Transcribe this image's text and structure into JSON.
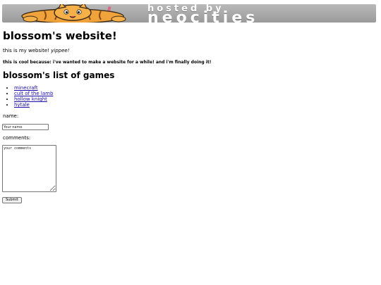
{
  "banner": {
    "hosted_text": "hosted by",
    "brand_text": "neocities"
  },
  "page": {
    "title": "blossom's website!",
    "intro_prefix": "this is my website! ",
    "intro_emphasis": "yippee!",
    "cool_text": "this is cool because: i've wanted to make a website for a while! and i'm finally doing it!"
  },
  "games": {
    "heading": "blossom's list of games",
    "items": [
      {
        "label": "minecraft"
      },
      {
        "label": "cult of the lamb"
      },
      {
        "label": "hollow knight"
      },
      {
        "label": "hytale"
      }
    ]
  },
  "form": {
    "name_label": "name:",
    "name_placeholder": "Your name",
    "comments_label": "comments:",
    "comments_placeholder": "your comments",
    "submit_label": "Submit"
  },
  "colors": {
    "link": "#1a0dab",
    "banner_gray": "#a9a9a9",
    "cat_orange": "#f0a33a"
  }
}
